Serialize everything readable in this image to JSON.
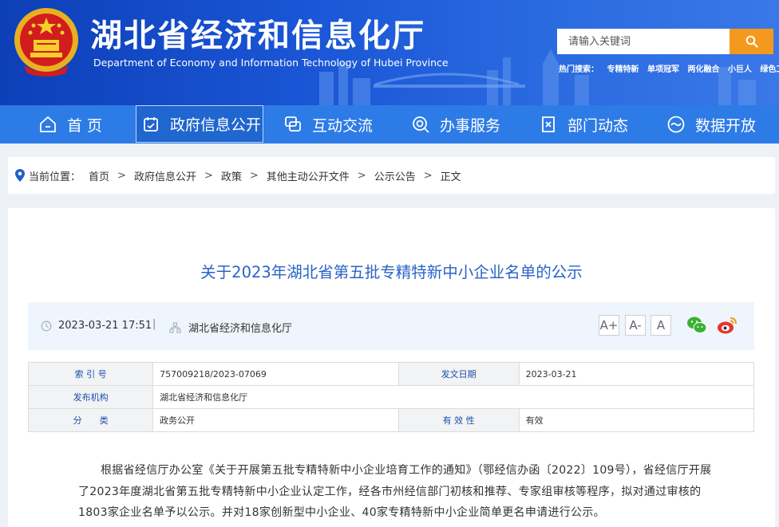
{
  "header": {
    "title": "湖北省经济和信息化厅",
    "subtitle": "Department of Economy and Information Technology of Hubei Province",
    "search_placeholder": "请输入关键词",
    "hot_label": "热门搜索：",
    "hot_items": [
      "专精特新",
      "单项冠军",
      "两化融合",
      "小巨人",
      "绿色工厂"
    ]
  },
  "nav": {
    "items": [
      {
        "label": "首 页",
        "icon": "home-icon"
      },
      {
        "label": "政府信息公开",
        "icon": "document-icon"
      },
      {
        "label": "互动交流",
        "icon": "chat-icon"
      },
      {
        "label": "办事服务",
        "icon": "service-icon"
      },
      {
        "label": "部门动态",
        "icon": "news-icon"
      },
      {
        "label": "数据开放",
        "icon": "data-icon"
      }
    ],
    "active": "政府信息公开"
  },
  "breadcrumb": {
    "label": "当前位置：",
    "items": [
      "首页",
      "政府信息公开",
      "政策",
      "其他主动公开文件",
      "公示公告",
      "正文"
    ]
  },
  "article": {
    "title": "关于2023年湖北省第五批专精特新中小企业名单的公示",
    "date": "2023-03-21 17:51",
    "publisher": "湖北省经济和信息化厅",
    "font_sizes": [
      "A+",
      "A-",
      "A"
    ],
    "info": {
      "index_label": "索 引 号",
      "index_value": "757009218/2023-07069",
      "date_label": "发文日期",
      "date_value": "2023-03-21",
      "org_label": "发布机构",
      "org_value": "湖北省经济和信息化厅",
      "cat_label": "分　　类",
      "cat_value": "政务公开",
      "valid_label": "有 效 性",
      "valid_value": "有效"
    },
    "body": "根据省经信厅办公室《关于开展第五批专精特新中小企业培育工作的通知》（鄂经信办函〔2022〕109号），省经信厅开展了2023年度湖北省第五批专精特新中小企业认定工作，经各市州经信部门初核和推荐、专家组审核等程序，拟对通过审核的1803家企业名单予以公示。并对18家创新型中小企业、40家专精特新中小企业简单更名申请进行公示。"
  },
  "colors": {
    "header_blue": "#1a56d6",
    "nav_blue": "#2d7be6",
    "title_blue": "#2a63c6",
    "search_orange": "#f39a1e"
  }
}
